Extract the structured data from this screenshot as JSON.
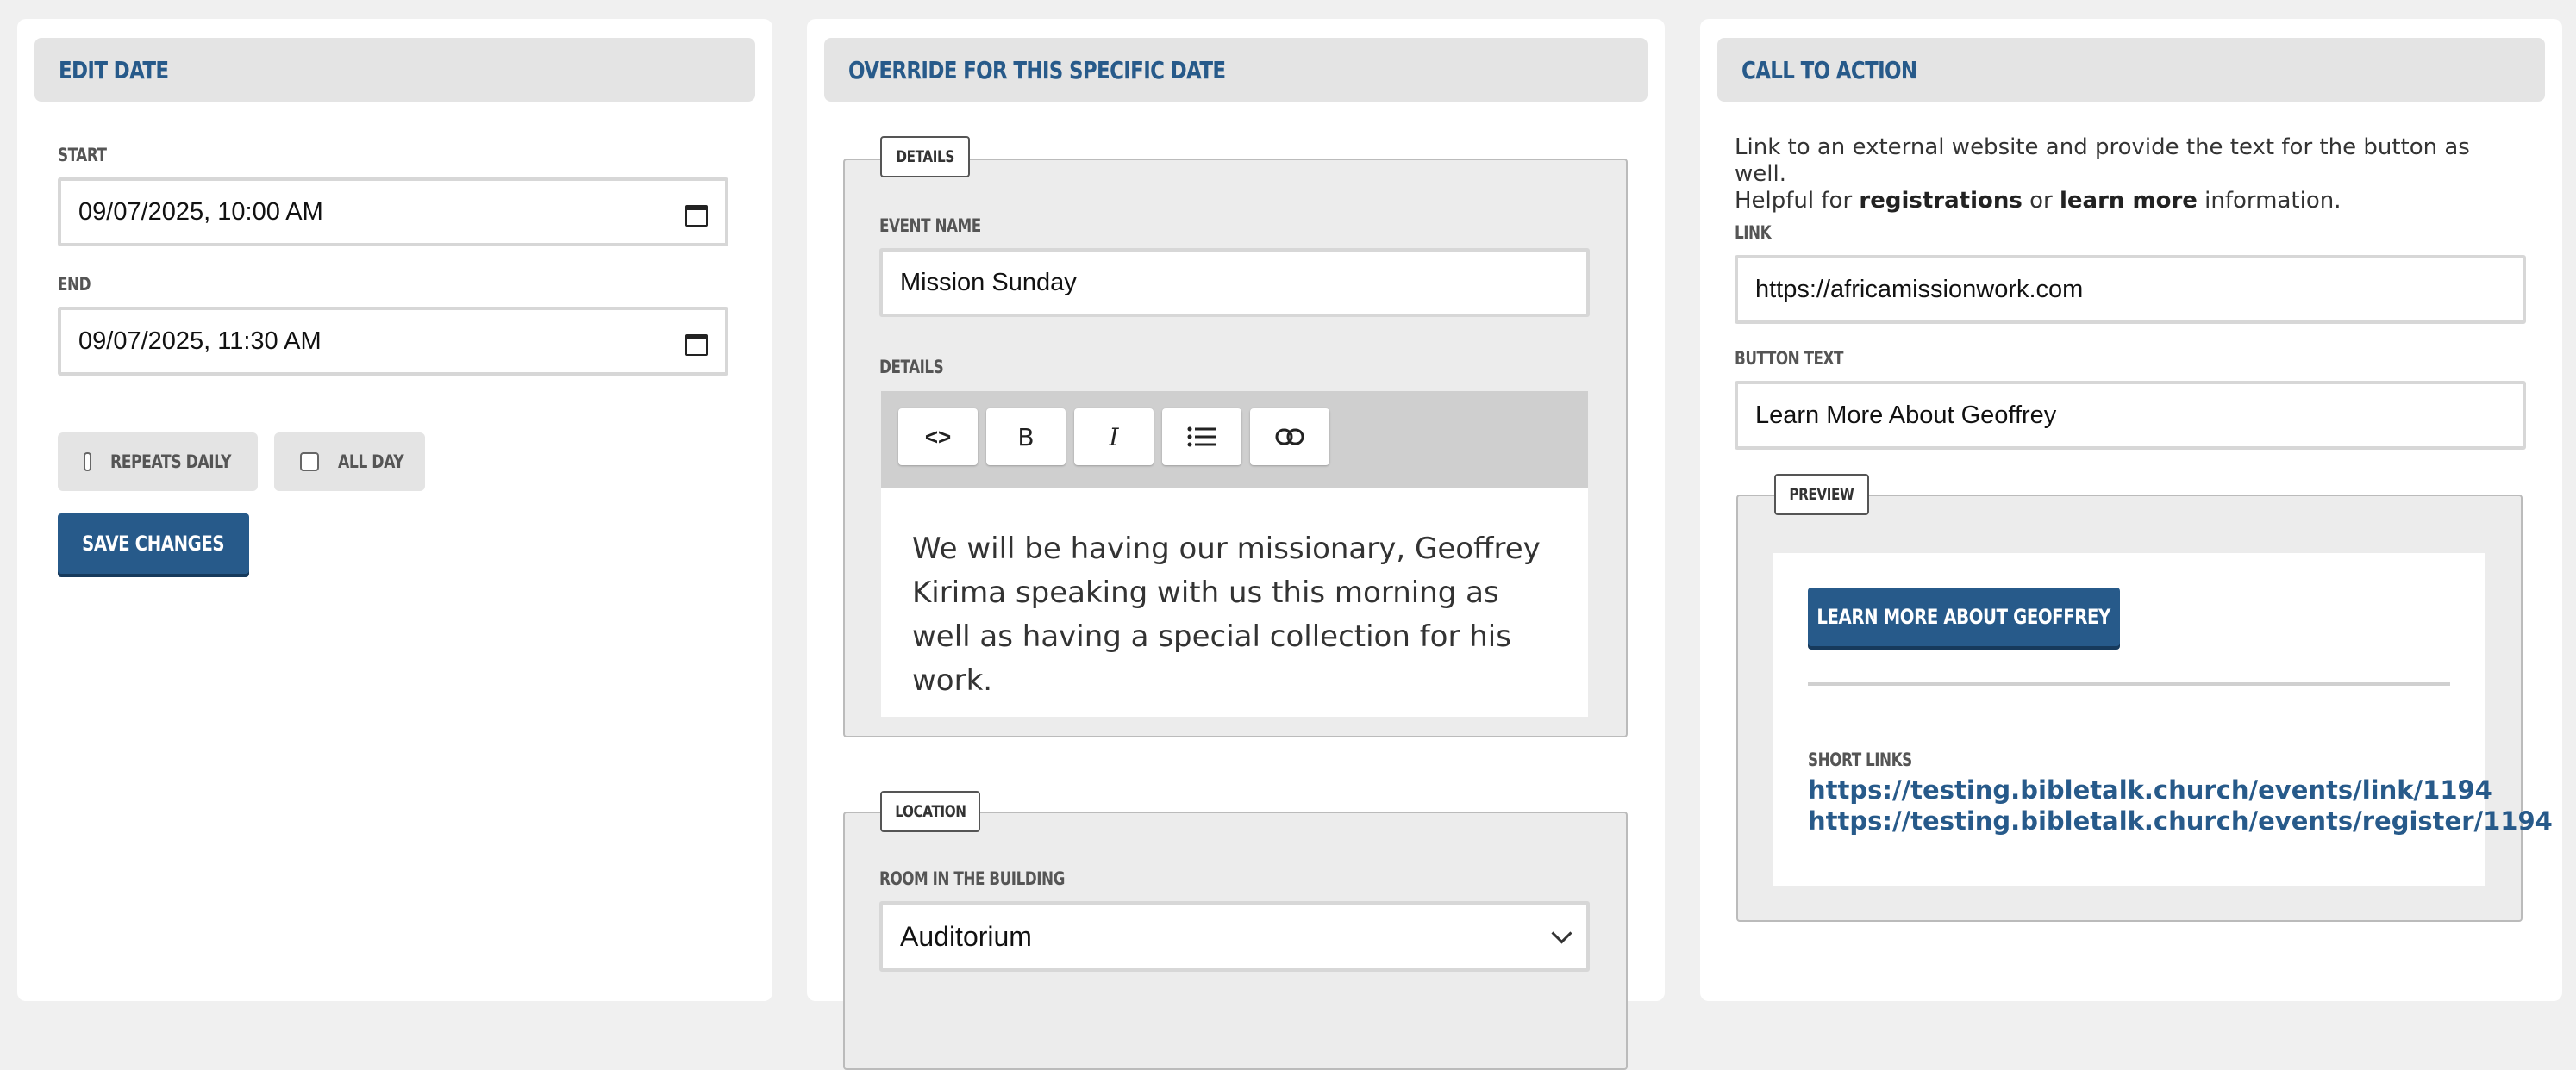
{
  "edit_date": {
    "header": "EDIT DATE",
    "start_label": "START",
    "start_value": "09/07/2025, 10:00  AM",
    "end_label": "END",
    "end_value": "09/07/2025, 11:30  AM",
    "repeats_daily_label": "REPEATS DAILY",
    "all_day_label": "ALL DAY",
    "save_label": "SAVE CHANGES"
  },
  "override": {
    "header": "OVERRIDE FOR THIS SPECIFIC DATE",
    "details_legend": "DETAILS",
    "event_name_label": "EVENT NAME",
    "event_name_value": "Mission Sunday",
    "details_label": "DETAILS",
    "toolbar": {
      "code": "<>",
      "bold": "B",
      "italic": "I"
    },
    "details_text": "We will be having our missionary, Geoffrey Kirima speaking with us this morning as well as having a special collection for his work.",
    "location_legend": "LOCATION",
    "room_label": "ROOM IN THE BUILDING",
    "room_value": "Auditorium"
  },
  "cta": {
    "header": "CALL TO ACTION",
    "desc_line1": "Link to an external website and provide the text for the button as well.",
    "desc_helpful": "Helpful for ",
    "desc_registrations": "registrations",
    "desc_or": " or ",
    "desc_learn_more": "learn more",
    "desc_information": " information.",
    "link_label": "LINK",
    "link_value": "https://africamissionwork.com",
    "button_text_label": "BUTTON TEXT",
    "button_text_value": "Learn More About Geoffrey",
    "preview_legend": "PREVIEW",
    "preview_button": "LEARN MORE ABOUT GEOFFREY",
    "short_links_label": "SHORT LINKS",
    "short_link_1": "https://testing.bibletalk.church/events/link/1194",
    "short_link_2": "https://testing.bibletalk.church/events/register/1194"
  },
  "colors": {
    "accent": "#275a8a",
    "panel_header_bg": "#e4e4e4",
    "page_bg": "#f0f0f0"
  }
}
